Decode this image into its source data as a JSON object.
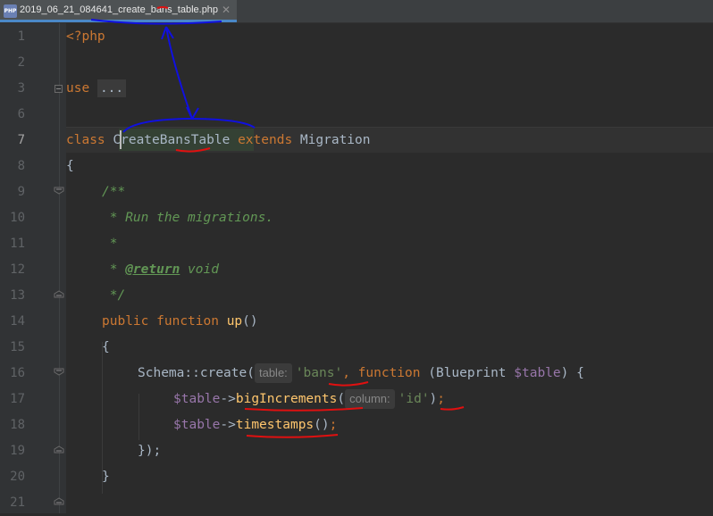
{
  "tab": {
    "icon_label": "PHP",
    "title": "2019_06_21_084641_create_bans_table.php",
    "close": "✕"
  },
  "gutter": {
    "line_numbers": [
      "1",
      "2",
      "3",
      "6",
      "7",
      "8",
      "9",
      "10",
      "11",
      "12",
      "13",
      "14",
      "15",
      "16",
      "17",
      "18",
      "19",
      "20",
      "21"
    ]
  },
  "code": {
    "l1": {
      "open": "<?php"
    },
    "l3": {
      "kw": "use",
      "folded": "..."
    },
    "l7": {
      "kw_class": "class",
      "classname": "CreateBansTable",
      "kw_extends": "extends",
      "parent": "Migration"
    },
    "l8": {
      "brace": "{"
    },
    "l9": {
      "doc_open": "/**"
    },
    "l10": {
      "doc_text": " * Run the migrations."
    },
    "l11": {
      "doc_star": " *"
    },
    "l12": {
      "doc_star": " * ",
      "doc_tag": "@return",
      "doc_type": " void"
    },
    "l13": {
      "doc_close": " */"
    },
    "l14": {
      "kw_public": "public",
      "kw_function": "function",
      "fname": "up",
      "parens": "()"
    },
    "l15": {
      "brace": "{"
    },
    "l16": {
      "cls": "Schema",
      "op": "::",
      "method": "create",
      "lparen": "(",
      "hint_table": "table:",
      "str_bans": "'bans'",
      "comma": ",",
      "kw_function": "function",
      "sig_open": " (Blueprint ",
      "var_table": "$table",
      "sig_close": ") {"
    },
    "l17": {
      "var_table": "$table",
      "arrow": "->",
      "method": "bigIncrements",
      "lparen": "(",
      "hint_column": "column:",
      "str_id": "'id'",
      "rparen": ")",
      "semi": ";"
    },
    "l18": {
      "var_table": "$table",
      "arrow": "->",
      "method": "timestamps",
      "parens": "()",
      "semi": ";"
    },
    "l19": {
      "close": "});"
    },
    "l20": {
      "brace": "}"
    }
  },
  "colors": {
    "background": "#2b2b2b",
    "keyword": "#cc7832",
    "function": "#ffc66d",
    "string": "#6a8759",
    "variable": "#9876aa",
    "doc_comment": "#629755",
    "annotation_blue": "#1010e0",
    "annotation_red": "#e01010"
  }
}
